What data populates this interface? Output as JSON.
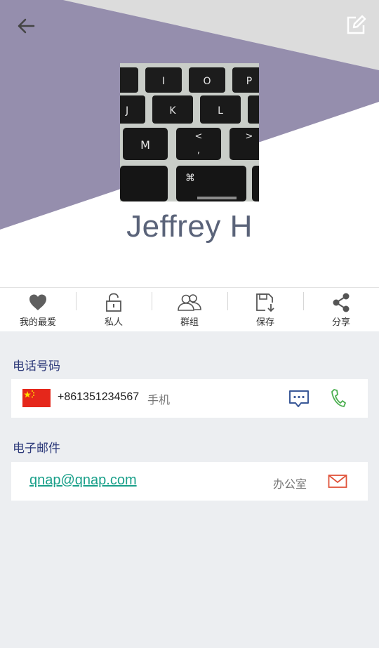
{
  "contact": {
    "name": "Jeffrey H"
  },
  "header": {
    "back_icon": "arrow-left-icon",
    "edit_icon": "edit-icon",
    "avatar_desc": "keyboard-photo"
  },
  "actions": [
    {
      "label": "我的最爱",
      "icon": "heart-icon"
    },
    {
      "label": "私人",
      "icon": "unlock-icon"
    },
    {
      "label": "群组",
      "icon": "group-icon"
    },
    {
      "label": "保存",
      "icon": "save-icon"
    },
    {
      "label": "分享",
      "icon": "share-icon"
    }
  ],
  "phone_section": {
    "title": "电话号码",
    "number": "+861351234567",
    "type": "手机",
    "flag": "china-flag"
  },
  "email_section": {
    "title": "电子邮件",
    "address": "qnap@qnap.com",
    "type": "办公室"
  },
  "colors": {
    "header_purple": "#958ead",
    "header_gray": "#dcdcdc",
    "name_text": "#5a6379",
    "section_title": "#2d3a7a",
    "email_link": "#1aa08a",
    "call_icon": "#4caf50",
    "mail_icon": "#e0533a",
    "sms_icon": "#3b5998"
  }
}
